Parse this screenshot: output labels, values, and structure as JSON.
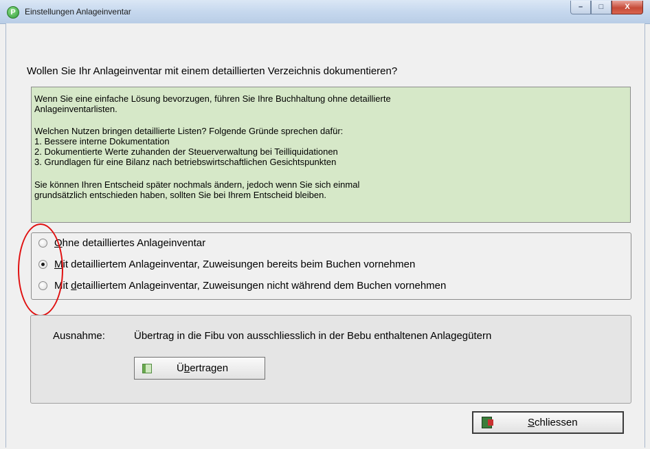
{
  "window": {
    "title": "Einstellungen Anlageinventar",
    "controls": [
      "–",
      "□",
      "X"
    ]
  },
  "question": "Wollen Sie Ihr Anlageinventar mit einem detaillierten Verzeichnis dokumentieren?",
  "info": {
    "line1": "Wenn Sie eine einfache Lösung bevorzugen, führen Sie Ihre Buchhaltung ohne detaillierte",
    "line2": "Anlageinventarlisten.",
    "line3": "Welchen Nutzen bringen detaillierte Listen? Folgende Gründe sprechen dafür:",
    "line4": "1. Bessere interne Dokumentation",
    "line5": "2. Dokumentierte Werte zuhanden der Steuerverwaltung bei Teilliquidationen",
    "line6": "3. Grundlagen für eine Bilanz nach betriebswirtschaftlichen Gesichtspunkten",
    "line7": "Sie können Ihren Entscheid später nochmals ändern, jedoch wenn Sie sich einmal",
    "line8": "grundsätzlich entschieden haben, sollten Sie bei Ihrem Entscheid bleiben."
  },
  "options": {
    "opt1": {
      "accel": "O",
      "rest": "hne detailliertes Anlageinventar",
      "checked": false
    },
    "opt2": {
      "accel": "M",
      "rest": "it detailliertem Anlageinventar, Zuweisungen bereits beim Buchen vornehmen",
      "checked": true
    },
    "opt3": {
      "pre": "Mit ",
      "accel": "d",
      "rest": "etailliertem Anlageinventar, Zuweisungen nicht während dem Buchen vornehmen",
      "checked": false
    }
  },
  "exception": {
    "label": "Ausnahme:",
    "text": "Übertrag in die Fibu von ausschliesslich in der Bebu enthaltenen Anlagegütern"
  },
  "buttons": {
    "transfer": {
      "pre": "Ü",
      "accel": "b",
      "rest": "ertragen"
    },
    "close": {
      "accel": "S",
      "rest": "chliessen"
    }
  },
  "colors": {
    "info_background": "#d6e8c8",
    "annotation_ellipse": "#e01010"
  }
}
